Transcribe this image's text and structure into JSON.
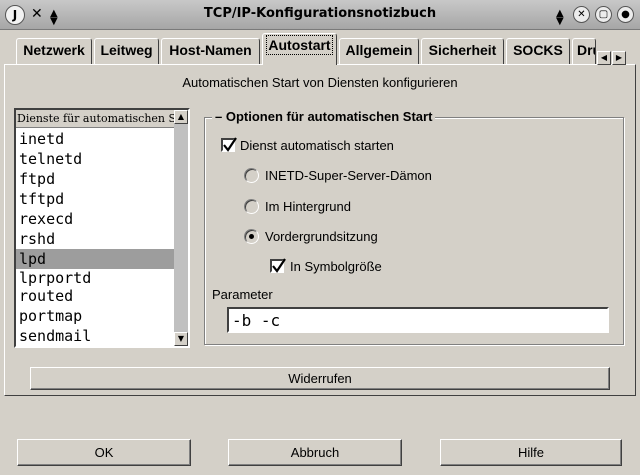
{
  "window": {
    "title": "TCP/IP-Konfigurationsnotizbuch"
  },
  "tabs": [
    {
      "label": "Netzwerk"
    },
    {
      "label": "Leitweg"
    },
    {
      "label": "Host-Namen"
    },
    {
      "label": "Autostart",
      "active": true
    },
    {
      "label": "Allgemein"
    },
    {
      "label": "Sicherheit"
    },
    {
      "label": "SOCKS"
    },
    {
      "label": "Dru"
    }
  ],
  "page": {
    "heading": "Automatischen Start von Diensten konfigurieren"
  },
  "services": {
    "header": "Dienste für automatischen Start",
    "items": [
      "inetd",
      "telnetd",
      "ftpd",
      "tftpd",
      "rexecd",
      "rshd",
      "lpd",
      "lprportd",
      "routed",
      "portmap",
      "sendmail"
    ],
    "selected": "lpd"
  },
  "options": {
    "title": "Optionen für automatischen Start",
    "autostart": {
      "label": "Dienst automatisch starten",
      "checked": true
    },
    "modes": [
      {
        "label": "INETD-Super-Server-Dämon",
        "selected": false
      },
      {
        "label": "Im Hintergrund",
        "selected": false
      },
      {
        "label": "Vordergrundsitzung",
        "selected": true
      }
    ],
    "minimized": {
      "label": "In Symbolgröße",
      "checked": true
    },
    "parameter": {
      "label": "Parameter",
      "value": "-b -c"
    }
  },
  "buttons": {
    "undo": "Widerrufen",
    "ok": "OK",
    "cancel": "Abbruch",
    "help": "Hilfe"
  }
}
